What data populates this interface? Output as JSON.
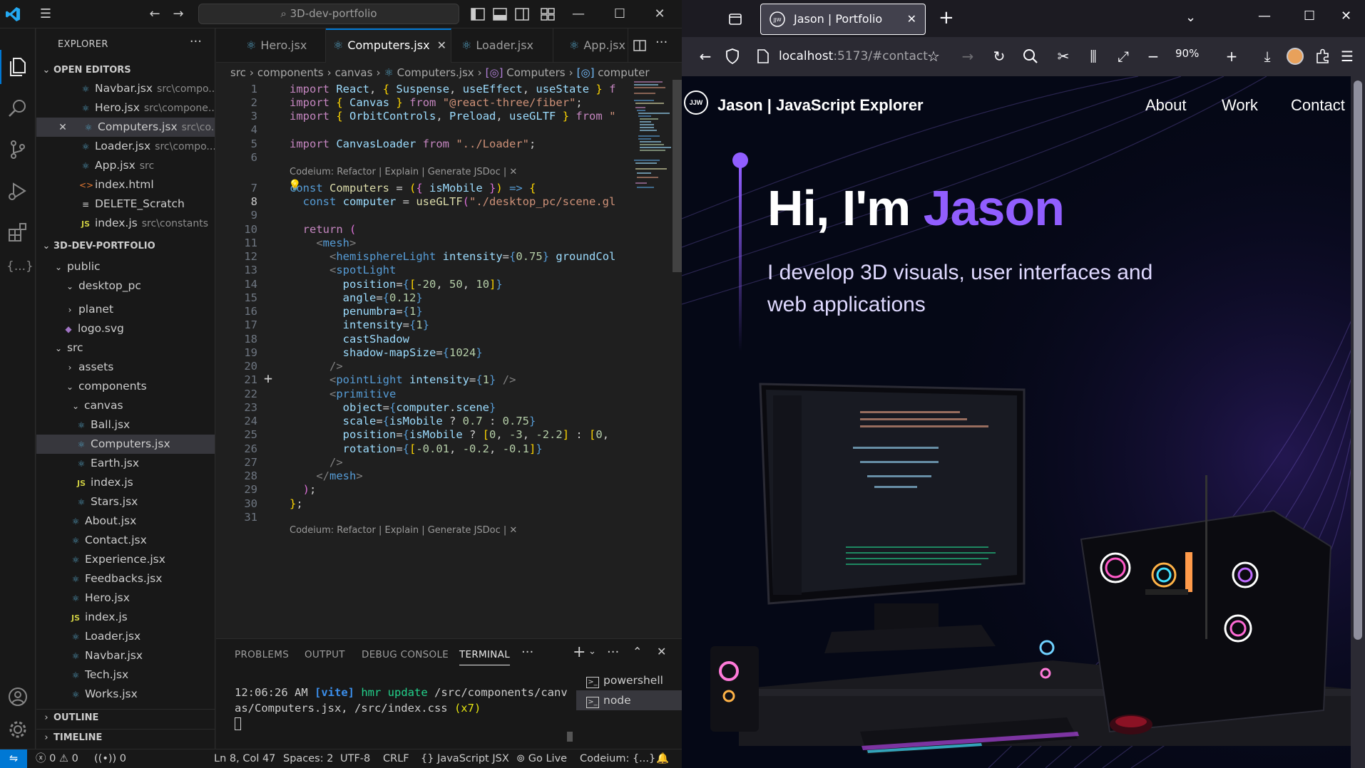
{
  "vscode": {
    "search": "3D-dev-portfolio",
    "explorer_title": "EXPLORER",
    "open_editors_title": "OPEN EDITORS",
    "open_editors": [
      {
        "name": "Navbar.jsx",
        "path": "src\\compo..."
      },
      {
        "name": "Hero.jsx",
        "path": "src\\compone..."
      },
      {
        "name": "Computers.jsx",
        "path": "src\\co..."
      },
      {
        "name": "Loader.jsx",
        "path": "src\\compo..."
      },
      {
        "name": "App.jsx",
        "path": "src"
      },
      {
        "name": "index.html",
        "path": ""
      },
      {
        "name": "DELETE_Scratch",
        "path": ""
      },
      {
        "name": "index.js",
        "path": "src\\constants"
      }
    ],
    "project_title": "3D-DEV-PORTFOLIO",
    "tree": [
      "public",
      "desktop_pc",
      "planet",
      "logo.svg",
      "src",
      "assets",
      "components",
      "canvas",
      "Ball.jsx",
      "Computers.jsx",
      "Earth.jsx",
      "index.js",
      "Stars.jsx",
      "About.jsx",
      "Contact.jsx",
      "Experience.jsx",
      "Feedbacks.jsx",
      "Hero.jsx",
      "index.js",
      "Loader.jsx",
      "Navbar.jsx",
      "Tech.jsx",
      "Works.jsx"
    ],
    "outline_title": "OUTLINE",
    "timeline_title": "TIMELINE",
    "tabs": [
      "Hero.jsx",
      "Computers.jsx",
      "Loader.jsx",
      "App.jsx"
    ],
    "breadcrumb": [
      "src",
      "components",
      "canvas",
      "Computers.jsx",
      "Computers",
      "computer"
    ],
    "codelens": "Codeium: Refactor | Explain | Generate JSDoc | ✕",
    "panel_tabs": [
      "PROBLEMS",
      "OUTPUT",
      "DEBUG CONSOLE",
      "TERMINAL"
    ],
    "terminal": {
      "time": "12:06:26 AM",
      "tag": "[vite]",
      "msg": "hmr update",
      "line1_path": "/src/components/canv",
      "line2_path": "as/Computers.jsx, /src/index.css",
      "count": "(x7)"
    },
    "terminal_list": [
      "powershell",
      "node"
    ],
    "status": {
      "errors": "0",
      "warnings": "0",
      "ports": "0",
      "position": "Ln 8, Col 47",
      "spaces": "Spaces: 2",
      "encoding": "UTF-8",
      "eol": "CRLF",
      "language": "JavaScript JSX",
      "golive": "Go Live",
      "codeium": "Codeium: {...}"
    }
  },
  "browser": {
    "tab_title": "Jason | Portfolio",
    "url_host": "localhost",
    "url_rest": ":5173/#contact",
    "zoom": "90%"
  },
  "site": {
    "logo": "JJW",
    "brand": "Jason | JavaScript Explorer",
    "nav": [
      "About",
      "Work",
      "Contact"
    ],
    "hero_prefix": "Hi, I'm ",
    "hero_name": "Jason",
    "hero_sub": "I develop 3D visuals, user interfaces and web applications"
  },
  "colors": {
    "accent": "#915eff",
    "vscode_blue": "#0078d4",
    "site_bg": "#050816"
  }
}
